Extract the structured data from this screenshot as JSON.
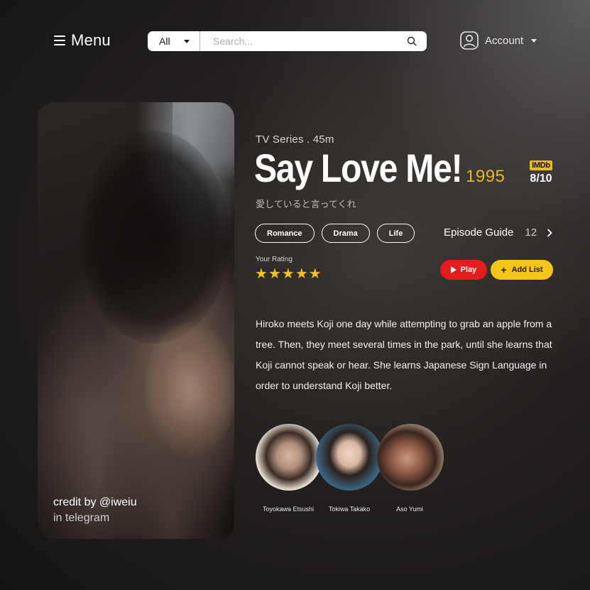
{
  "header": {
    "menu_label": "Menu",
    "search": {
      "category": "All",
      "placeholder": "Search..."
    },
    "account_label": "Account"
  },
  "poster": {
    "credit_line1": "credit by @iweiu",
    "credit_line2": "in telegram"
  },
  "show": {
    "meta": "TV Series . 45m",
    "title": "Say Love Me!",
    "year": "1995",
    "japanese_title": "愛していると言ってくれ",
    "imdb": {
      "logo": "IMDb",
      "score": "8/10"
    },
    "genres": [
      "Romance",
      "Drama",
      "Life"
    ],
    "episode_guide": {
      "label": "Episode Guide",
      "count": "12"
    },
    "rating": {
      "label": "Your Rating",
      "stars": 5,
      "max": 5
    },
    "actions": {
      "play": "Play",
      "add": "Add List"
    },
    "synopsis": "Hiroko meets Koji one day while attempting to grab an apple from a tree. Then, they meet several times in the park, until she learns that Koji cannot speak or hear. She learns Japanese Sign Language in order to understand Koji better.",
    "cast": [
      {
        "name": "Toyokawa Etsushi"
      },
      {
        "name": "Tokiwa Takako"
      },
      {
        "name": "Aso Yumi"
      }
    ]
  },
  "colors": {
    "accent_gold": "#e9b923",
    "play_red": "#e21c1c",
    "add_yellow": "#f5c518",
    "star": "#f4c11f"
  }
}
